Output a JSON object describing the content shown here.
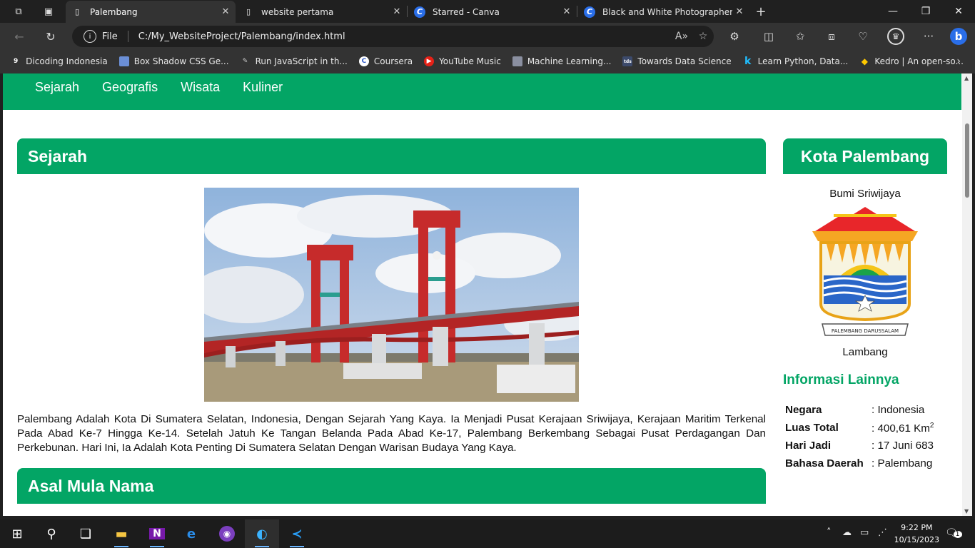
{
  "tabs": [
    {
      "title": "Palembang",
      "icon": "page-icon",
      "active": true
    },
    {
      "title": "website pertama",
      "icon": "page-icon"
    },
    {
      "title": "Starred - Canva",
      "icon": "canva-icon"
    },
    {
      "title": "Black and White Photographer P",
      "icon": "canva-icon"
    }
  ],
  "address": {
    "scheme": "File",
    "url": "C:/My_WebsiteProject/Palembang/index.html"
  },
  "bookmarks": [
    {
      "label": "Dicoding Indonesia",
      "icon": "dicoding-icon"
    },
    {
      "label": "Box Shadow CSS Ge...",
      "icon": "bookmark-box-icon"
    },
    {
      "label": "Run JavaScript in th...",
      "icon": "runjs-icon"
    },
    {
      "label": "Coursera",
      "icon": "coursera-icon"
    },
    {
      "label": "YouTube Music",
      "icon": "youtube-music-icon"
    },
    {
      "label": "Machine Learning...",
      "icon": "ml-icon"
    },
    {
      "label": "Towards Data Science",
      "icon": "tds-icon"
    },
    {
      "label": "Learn Python, Data...",
      "icon": "kaggle-icon"
    },
    {
      "label": "Kedro | An open-so...",
      "icon": "kedro-icon"
    }
  ],
  "nav": [
    "Sejarah",
    "Geografis",
    "Wisata",
    "Kuliner"
  ],
  "main": {
    "sejarah_heading": "Sejarah",
    "sejarah_text": "Palembang Adalah Kota Di Sumatera Selatan, Indonesia, Dengan Sejarah Yang Kaya. Ia Menjadi Pusat Kerajaan Sriwijaya, Kerajaan Maritim Terkenal Pada Abad Ke-7 Hingga Ke-14. Setelah Jatuh Ke Tangan Belanda Pada Abad Ke-17, Palembang Berkembang Sebagai Pusat Perdagangan Dan Perkebunan. Hari Ini, Ia Adalah Kota Penting Di Sumatera Selatan Dengan Warisan Budaya Yang Kaya.",
    "asal_heading": "Asal Mula Nama"
  },
  "aside": {
    "heading": "Kota Palembang",
    "motto": "Bumi Sriwijaya",
    "emblem_caption": "Lambang",
    "emblem_ribbon": "PALEMBANG DARUSSALAM",
    "info_title": "Informasi Lainnya",
    "info": [
      {
        "key": "Negara",
        "value": ": Indonesia"
      },
      {
        "key": "Luas Total",
        "value": ": 400,61 Km",
        "sup": "2"
      },
      {
        "key": "Hari Jadi",
        "value": ": 17 Juni 683"
      },
      {
        "key": "Bahasa Daerah",
        "value": ": Palembang"
      }
    ]
  },
  "taskbar": {
    "time": "9:22 PM",
    "date": "10/15/2023",
    "notification_count": "1"
  },
  "colors": {
    "accent": "#03a565",
    "browser_dark": "#202020",
    "toolbar": "#333333"
  }
}
